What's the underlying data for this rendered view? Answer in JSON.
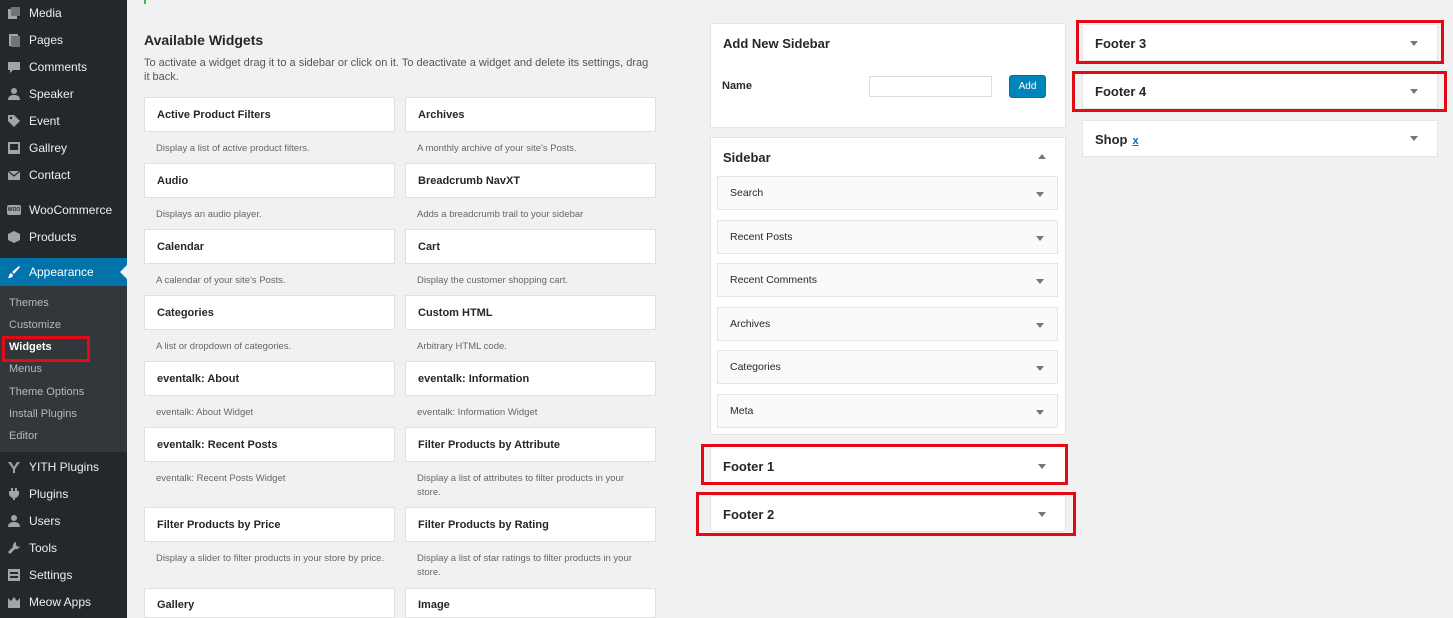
{
  "admin_menu": {
    "items": [
      {
        "label": "Media",
        "icon": "media-icon"
      },
      {
        "label": "Pages",
        "icon": "pages-icon"
      },
      {
        "label": "Comments",
        "icon": "comments-icon"
      },
      {
        "label": "Speaker",
        "icon": "user-icon"
      },
      {
        "label": "Event",
        "icon": "tag-icon"
      },
      {
        "label": "Gallrey",
        "icon": "gallery-icon"
      },
      {
        "label": "Contact",
        "icon": "email-icon"
      },
      {
        "label": "WooCommerce",
        "icon": "woocommerce-icon",
        "badge": "WOO"
      },
      {
        "label": "Products",
        "icon": "products-icon"
      },
      {
        "label": "Appearance",
        "icon": "appearance-brush-icon"
      },
      {
        "label": "YITH Plugins",
        "icon": "yith-icon"
      },
      {
        "label": "Plugins",
        "icon": "plugins-icon"
      },
      {
        "label": "Users",
        "icon": "users-icon"
      },
      {
        "label": "Tools",
        "icon": "tools-wrench-icon"
      },
      {
        "label": "Settings",
        "icon": "settings-icon"
      },
      {
        "label": "Meow Apps",
        "icon": "meow-apps-icon"
      }
    ],
    "current": "Appearance",
    "submenu": [
      "Themes",
      "Customize",
      "Widgets",
      "Menus",
      "Theme Options",
      "Install Plugins",
      "Editor"
    ],
    "submenu_current": "Widgets"
  },
  "available": {
    "title": "Available Widgets",
    "description": "To activate a widget drag it to a sidebar or click on it. To deactivate a widget and delete its settings, drag it back.",
    "widgets": [
      {
        "name": "Active Product Filters",
        "desc": "Display a list of active product filters."
      },
      {
        "name": "Archives",
        "desc": "A monthly archive of your site's Posts."
      },
      {
        "name": "Audio",
        "desc": "Displays an audio player."
      },
      {
        "name": "Breadcrumb NavXT",
        "desc": "Adds a breadcrumb trail to your sidebar"
      },
      {
        "name": "Calendar",
        "desc": "A calendar of your site's Posts."
      },
      {
        "name": "Cart",
        "desc": "Display the customer shopping cart."
      },
      {
        "name": "Categories",
        "desc": "A list or dropdown of categories."
      },
      {
        "name": "Custom HTML",
        "desc": "Arbitrary HTML code."
      },
      {
        "name": "eventalk: About",
        "desc": "eventalk: About Widget"
      },
      {
        "name": "eventalk: Information",
        "desc": "eventalk: Information Widget"
      },
      {
        "name": "eventalk: Recent Posts",
        "desc": "eventalk: Recent Posts Widget"
      },
      {
        "name": "Filter Products by Attribute",
        "desc": "Display a list of attributes to filter products in your store."
      },
      {
        "name": "Filter Products by Price",
        "desc": "Display a slider to filter products in your store by price."
      },
      {
        "name": "Filter Products by Rating",
        "desc": "Display a list of star ratings to filter products in your store."
      },
      {
        "name": "Gallery",
        "desc": ""
      },
      {
        "name": "Image",
        "desc": ""
      }
    ]
  },
  "add_sidebar": {
    "title": "Add New Sidebar",
    "name_label": "Name",
    "name_value": "",
    "add_label": "Add"
  },
  "sidebar": {
    "title": "Sidebar",
    "widgets": [
      "Search",
      "Recent Posts",
      "Recent Comments",
      "Archives",
      "Categories",
      "Meta"
    ]
  },
  "areas": {
    "footer1": "Footer 1",
    "footer2": "Footer 2",
    "footer3": "Footer 3",
    "footer4": "Footer 4",
    "shop": "Shop",
    "shop_link": "x"
  },
  "colors": {
    "admin_bg": "#23282d",
    "accent": "#0073aa",
    "highlight": "#e20a14"
  }
}
